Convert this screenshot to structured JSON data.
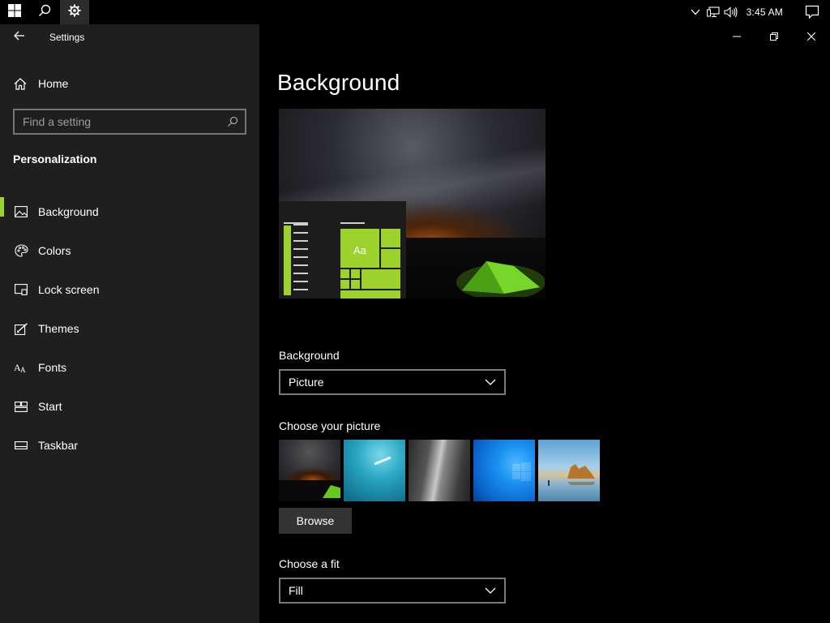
{
  "taskbar": {
    "start_icon": "windows-logo-icon",
    "search_icon": "search-icon",
    "settings_icon": "gear-icon",
    "clock": "3:45 AM",
    "tray_icons": [
      "chevron-up-icon",
      "network-icon",
      "volume-icon"
    ],
    "notification_icon": "action-center-icon"
  },
  "window": {
    "title": "Settings",
    "controls": [
      "minimize",
      "restore",
      "close"
    ]
  },
  "nav": {
    "home_label": "Home",
    "search_placeholder": "Find a setting",
    "section_title": "Personalization",
    "items": [
      {
        "label": "Background",
        "icon": "picture-icon",
        "active": true
      },
      {
        "label": "Colors",
        "icon": "palette-icon",
        "active": false
      },
      {
        "label": "Lock screen",
        "icon": "lock-screen-icon",
        "active": false
      },
      {
        "label": "Themes",
        "icon": "paintbrush-icon",
        "active": false
      },
      {
        "label": "Fonts",
        "icon": "font-icon",
        "active": false
      },
      {
        "label": "Start",
        "icon": "start-icon",
        "active": false
      },
      {
        "label": "Taskbar",
        "icon": "taskbar-icon",
        "active": false
      }
    ]
  },
  "main": {
    "title": "Background",
    "preview": {
      "sample_text": "Aa"
    },
    "background_label": "Background",
    "background_value": "Picture",
    "choose_picture_label": "Choose your picture",
    "thumbnails": [
      "night-sky-tent",
      "underwater-swimmer",
      "rock-cliff",
      "windows-blue",
      "beach-rocks"
    ],
    "browse_label": "Browse",
    "fit_label": "Choose a fit",
    "fit_value": "Fill"
  },
  "colors": {
    "accent": "#9cd22b",
    "nav_bg": "#1f1f1f",
    "main_bg": "#000000"
  }
}
